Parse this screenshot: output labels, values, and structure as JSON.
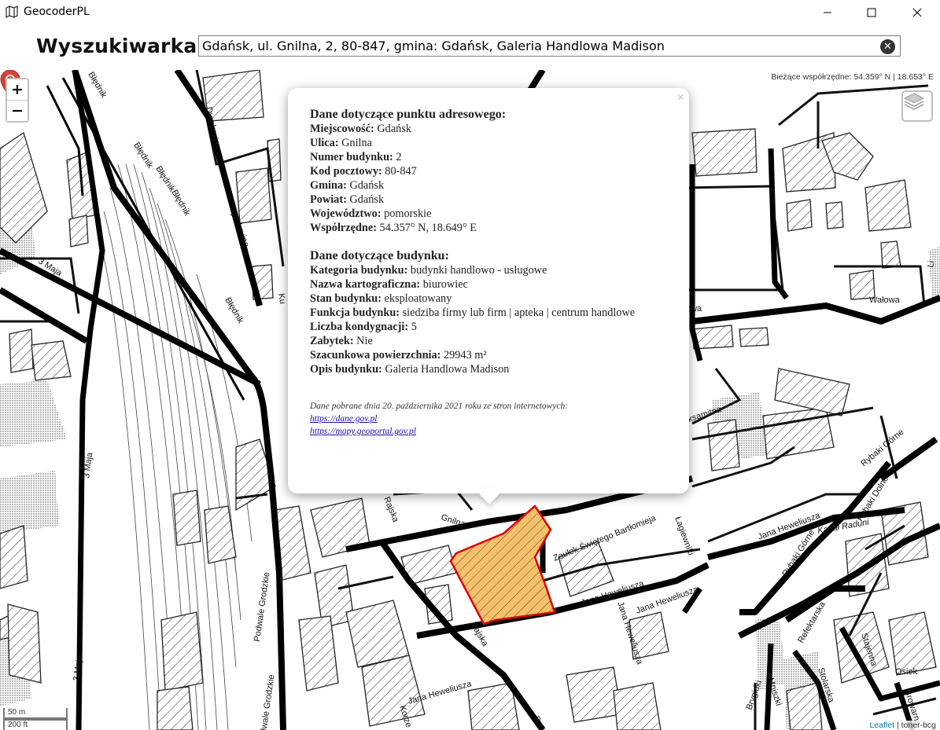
{
  "window": {
    "title": "GeocoderPL"
  },
  "search": {
    "label": "Wyszukiwarka:",
    "value": "Gdańsk, ul. Gnilna, 2, 80-847, gmina: Gdańsk, Galeria Handlowa Madison"
  },
  "map": {
    "zoom_in": "+",
    "zoom_out": "−",
    "coords_label": "Bieżące współrzędne: 54.359° N | 18.653° E",
    "scale_m": "50 m",
    "scale_ft": "200 ft",
    "attribution_link": "Leaflet",
    "attribution_rest": " | toner-bcg",
    "highlight_color": "#f5c06a",
    "highlight_border": "#e00000",
    "marker_color": "#d9413b",
    "streets": {
      "bl1": "Błędnik",
      "bl2": "Błędnik",
      "bl3": "Błędnik",
      "bl4": "Błędnik",
      "bl5": "Błędnik",
      "dyr1": "Dyrekcyjna",
      "dyr2": "Dyrekcyjna",
      "maj1": "3 Maja",
      "maj2": "3 Maja",
      "maj3": "3 Maja",
      "walowa1": "Wałowa",
      "walowa2": "owa",
      "rajska1": "Rajska",
      "rajska2": "Rajska",
      "rajska3": "Ra",
      "gnilna": "Gnilna",
      "podwale1": "Podwale Grodzkie",
      "podwale2": "dwale Grodzkie",
      "zaulek": "Zaułek Świętego Bartłomieja",
      "lagiewniki": "Łagiewniki",
      "hew1": "Jana Heweliusza",
      "hew2": "Jana Heweliusza",
      "hew3": "Jana Heweliusza",
      "hew4": "Jana Heweliusza",
      "hew5": "Jana Heweliusza",
      "hew6": "Jana Heweliusza",
      "rybaki_gorne1": "Rybaki Górne",
      "rybaki_gorne2": "Rybaki Górne",
      "rybaki_dolne": "Rybaki Dolne",
      "kanal": "Kanał Raduni",
      "refektarska": "Refektarska",
      "stolarska": "Stolarska",
      "stajenna": "Stajenna",
      "osiek": "Osiek",
      "browarna": "Browarna",
      "brygidki": "Brygidki",
      "mniszki": "Mniszki",
      "korzenna": "Korze",
      "aksamitna": "aksamitna",
      "ku": "Ku",
      "li": "Li"
    }
  },
  "popup": {
    "close": "×",
    "address_header": "Dane dotyczące punktu adresowego:",
    "address_rows": [
      {
        "label": "Miejscowość:",
        "value": " Gdańsk"
      },
      {
        "label": "Ulica:",
        "value": " Gnilna"
      },
      {
        "label": "Numer budynku:",
        "value": " 2"
      },
      {
        "label": "Kod pocztowy:",
        "value": " 80-847"
      },
      {
        "label": "Gmina:",
        "value": " Gdańsk"
      },
      {
        "label": "Powiat:",
        "value": " Gdańsk"
      },
      {
        "label": "Województwo:",
        "value": " pomorskie"
      },
      {
        "label": "Współrzędne:",
        "value": " 54.357° N, 18.649° E"
      }
    ],
    "building_header": "Dane dotyczące budynku:",
    "building_rows": [
      {
        "label": "Kategoria budynku:",
        "value": " budynki handlowo - usługowe"
      },
      {
        "label": "Nazwa kartograficzna:",
        "value": " biurowiec"
      },
      {
        "label": "Stan budynku:",
        "value": " eksploatowany"
      },
      {
        "label": "Funkcja budynku:",
        "value": " siedziba firmy lub firm | apteka | centrum handlowe"
      },
      {
        "label": "Liczba kondygnacji:",
        "value": " 5"
      },
      {
        "label": "Zabytek:",
        "value": " Nie"
      },
      {
        "label": "Szacunkowa powierzchnia:",
        "value": " 29943 m²"
      },
      {
        "label": "Opis budynku:",
        "value": " Galeria Handlowa Madison"
      }
    ],
    "footer_text": "Dane pobrane dnia 20. października 2021 roku ze stron internetowych:",
    "link1": "https://dane.gov.pl",
    "link2": "https://mapy.geoportal.gov.pl"
  }
}
